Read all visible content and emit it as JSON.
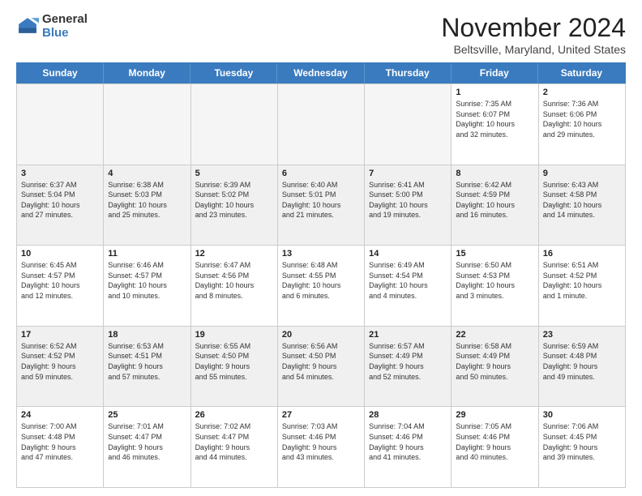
{
  "logo": {
    "general": "General",
    "blue": "Blue"
  },
  "title": "November 2024",
  "subtitle": "Beltsville, Maryland, United States",
  "days_of_week": [
    "Sunday",
    "Monday",
    "Tuesday",
    "Wednesday",
    "Thursday",
    "Friday",
    "Saturday"
  ],
  "weeks": [
    [
      {
        "day": "",
        "info": "",
        "empty": true
      },
      {
        "day": "",
        "info": "",
        "empty": true
      },
      {
        "day": "",
        "info": "",
        "empty": true
      },
      {
        "day": "",
        "info": "",
        "empty": true
      },
      {
        "day": "",
        "info": "",
        "empty": true
      },
      {
        "day": "1",
        "info": "Sunrise: 7:35 AM\nSunset: 6:07 PM\nDaylight: 10 hours\nand 32 minutes.",
        "empty": false
      },
      {
        "day": "2",
        "info": "Sunrise: 7:36 AM\nSunset: 6:06 PM\nDaylight: 10 hours\nand 29 minutes.",
        "empty": false
      }
    ],
    [
      {
        "day": "3",
        "info": "Sunrise: 6:37 AM\nSunset: 5:04 PM\nDaylight: 10 hours\nand 27 minutes.",
        "empty": false
      },
      {
        "day": "4",
        "info": "Sunrise: 6:38 AM\nSunset: 5:03 PM\nDaylight: 10 hours\nand 25 minutes.",
        "empty": false
      },
      {
        "day": "5",
        "info": "Sunrise: 6:39 AM\nSunset: 5:02 PM\nDaylight: 10 hours\nand 23 minutes.",
        "empty": false
      },
      {
        "day": "6",
        "info": "Sunrise: 6:40 AM\nSunset: 5:01 PM\nDaylight: 10 hours\nand 21 minutes.",
        "empty": false
      },
      {
        "day": "7",
        "info": "Sunrise: 6:41 AM\nSunset: 5:00 PM\nDaylight: 10 hours\nand 19 minutes.",
        "empty": false
      },
      {
        "day": "8",
        "info": "Sunrise: 6:42 AM\nSunset: 4:59 PM\nDaylight: 10 hours\nand 16 minutes.",
        "empty": false
      },
      {
        "day": "9",
        "info": "Sunrise: 6:43 AM\nSunset: 4:58 PM\nDaylight: 10 hours\nand 14 minutes.",
        "empty": false
      }
    ],
    [
      {
        "day": "10",
        "info": "Sunrise: 6:45 AM\nSunset: 4:57 PM\nDaylight: 10 hours\nand 12 minutes.",
        "empty": false
      },
      {
        "day": "11",
        "info": "Sunrise: 6:46 AM\nSunset: 4:57 PM\nDaylight: 10 hours\nand 10 minutes.",
        "empty": false
      },
      {
        "day": "12",
        "info": "Sunrise: 6:47 AM\nSunset: 4:56 PM\nDaylight: 10 hours\nand 8 minutes.",
        "empty": false
      },
      {
        "day": "13",
        "info": "Sunrise: 6:48 AM\nSunset: 4:55 PM\nDaylight: 10 hours\nand 6 minutes.",
        "empty": false
      },
      {
        "day": "14",
        "info": "Sunrise: 6:49 AM\nSunset: 4:54 PM\nDaylight: 10 hours\nand 4 minutes.",
        "empty": false
      },
      {
        "day": "15",
        "info": "Sunrise: 6:50 AM\nSunset: 4:53 PM\nDaylight: 10 hours\nand 3 minutes.",
        "empty": false
      },
      {
        "day": "16",
        "info": "Sunrise: 6:51 AM\nSunset: 4:52 PM\nDaylight: 10 hours\nand 1 minute.",
        "empty": false
      }
    ],
    [
      {
        "day": "17",
        "info": "Sunrise: 6:52 AM\nSunset: 4:52 PM\nDaylight: 9 hours\nand 59 minutes.",
        "empty": false
      },
      {
        "day": "18",
        "info": "Sunrise: 6:53 AM\nSunset: 4:51 PM\nDaylight: 9 hours\nand 57 minutes.",
        "empty": false
      },
      {
        "day": "19",
        "info": "Sunrise: 6:55 AM\nSunset: 4:50 PM\nDaylight: 9 hours\nand 55 minutes.",
        "empty": false
      },
      {
        "day": "20",
        "info": "Sunrise: 6:56 AM\nSunset: 4:50 PM\nDaylight: 9 hours\nand 54 minutes.",
        "empty": false
      },
      {
        "day": "21",
        "info": "Sunrise: 6:57 AM\nSunset: 4:49 PM\nDaylight: 9 hours\nand 52 minutes.",
        "empty": false
      },
      {
        "day": "22",
        "info": "Sunrise: 6:58 AM\nSunset: 4:49 PM\nDaylight: 9 hours\nand 50 minutes.",
        "empty": false
      },
      {
        "day": "23",
        "info": "Sunrise: 6:59 AM\nSunset: 4:48 PM\nDaylight: 9 hours\nand 49 minutes.",
        "empty": false
      }
    ],
    [
      {
        "day": "24",
        "info": "Sunrise: 7:00 AM\nSunset: 4:48 PM\nDaylight: 9 hours\nand 47 minutes.",
        "empty": false
      },
      {
        "day": "25",
        "info": "Sunrise: 7:01 AM\nSunset: 4:47 PM\nDaylight: 9 hours\nand 46 minutes.",
        "empty": false
      },
      {
        "day": "26",
        "info": "Sunrise: 7:02 AM\nSunset: 4:47 PM\nDaylight: 9 hours\nand 44 minutes.",
        "empty": false
      },
      {
        "day": "27",
        "info": "Sunrise: 7:03 AM\nSunset: 4:46 PM\nDaylight: 9 hours\nand 43 minutes.",
        "empty": false
      },
      {
        "day": "28",
        "info": "Sunrise: 7:04 AM\nSunset: 4:46 PM\nDaylight: 9 hours\nand 41 minutes.",
        "empty": false
      },
      {
        "day": "29",
        "info": "Sunrise: 7:05 AM\nSunset: 4:46 PM\nDaylight: 9 hours\nand 40 minutes.",
        "empty": false
      },
      {
        "day": "30",
        "info": "Sunrise: 7:06 AM\nSunset: 4:45 PM\nDaylight: 9 hours\nand 39 minutes.",
        "empty": false
      }
    ]
  ]
}
